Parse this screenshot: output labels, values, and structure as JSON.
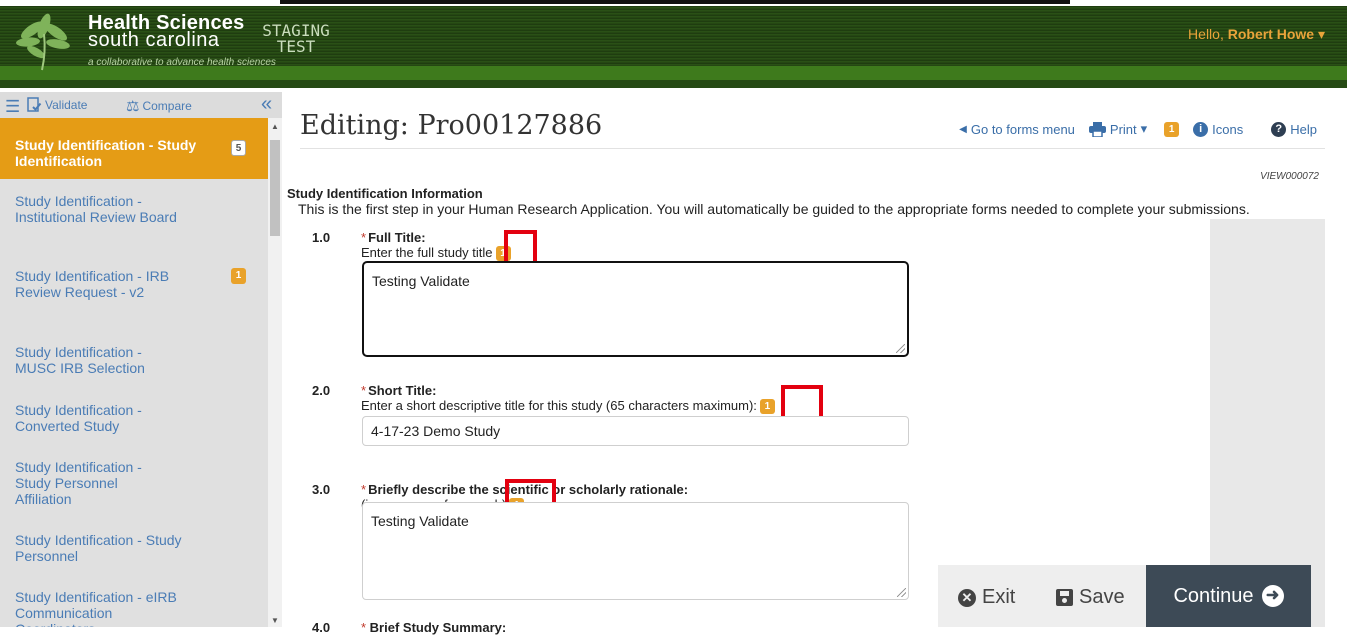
{
  "header": {
    "logo_line1": "Health Sciences",
    "logo_line2": "south carolina",
    "logo_tagline": "a collaborative to advance health sciences",
    "env_label": "STAGING TEST",
    "greeting_prefix": "Hello,",
    "user_name": "Robert Howe"
  },
  "sidebar": {
    "toolbar": {
      "validate_label": "Validate",
      "compare_label": "Compare"
    },
    "items": [
      {
        "label": "Study Identification - Study Identification",
        "active": true,
        "badge": "5"
      },
      {
        "label": "Study Identification - Institutional Review Board",
        "active": false,
        "badge": ""
      },
      {
        "label": "Study Identification - IRB Review Request - v2",
        "active": false,
        "badge": "1"
      },
      {
        "label": "Study Identification - MUSC IRB Selection",
        "active": false,
        "badge": ""
      },
      {
        "label": "Study Identification - Converted Study",
        "active": false,
        "badge": ""
      },
      {
        "label": "Study Identification - Study Personnel Affiliation",
        "active": false,
        "badge": ""
      },
      {
        "label": "Study Identification - Study Personnel",
        "active": false,
        "badge": ""
      },
      {
        "label": "Study Identification - eIRB Communication Coordinators",
        "active": false,
        "badge": ""
      }
    ]
  },
  "main": {
    "title": "Editing: Pro00127886",
    "actions": {
      "forms_menu": "Go to forms menu",
      "print": "Print",
      "badge": "1",
      "icons": "Icons",
      "help": "Help"
    },
    "view_id": "VIEW000072",
    "section_heading": "Study Identification Information",
    "section_desc": "This is the first step in your Human Research Application.  You will automatically be guided to the appropriate forms needed to complete your submissions.",
    "questions": [
      {
        "num": "1.0",
        "label": "Full Title:",
        "help": "Enter the full study title",
        "value": "Testing Validate",
        "badge": "1"
      },
      {
        "num": "2.0",
        "label": "Short Title:",
        "help": "Enter a short descriptive title for this study (65 characters maximum):",
        "value": "4-17-23 Demo Study",
        "badge": "1"
      },
      {
        "num": "3.0",
        "label": "Briefly describe the scientific or scholarly rationale:",
        "help": "(i.e. purpose of research)",
        "value": "Testing Validate",
        "badge": "1"
      },
      {
        "num": "4.0",
        "label": "Brief Study Summary:"
      }
    ]
  },
  "action_bar": {
    "exit": "Exit",
    "save": "Save",
    "continue": "Continue"
  },
  "colors": {
    "accent_orange": "#e59c15",
    "link_blue": "#4a7cb5",
    "header_green": "#2a5016",
    "continue_bg": "#3d4a56",
    "annotation_red": "#e3000f"
  }
}
